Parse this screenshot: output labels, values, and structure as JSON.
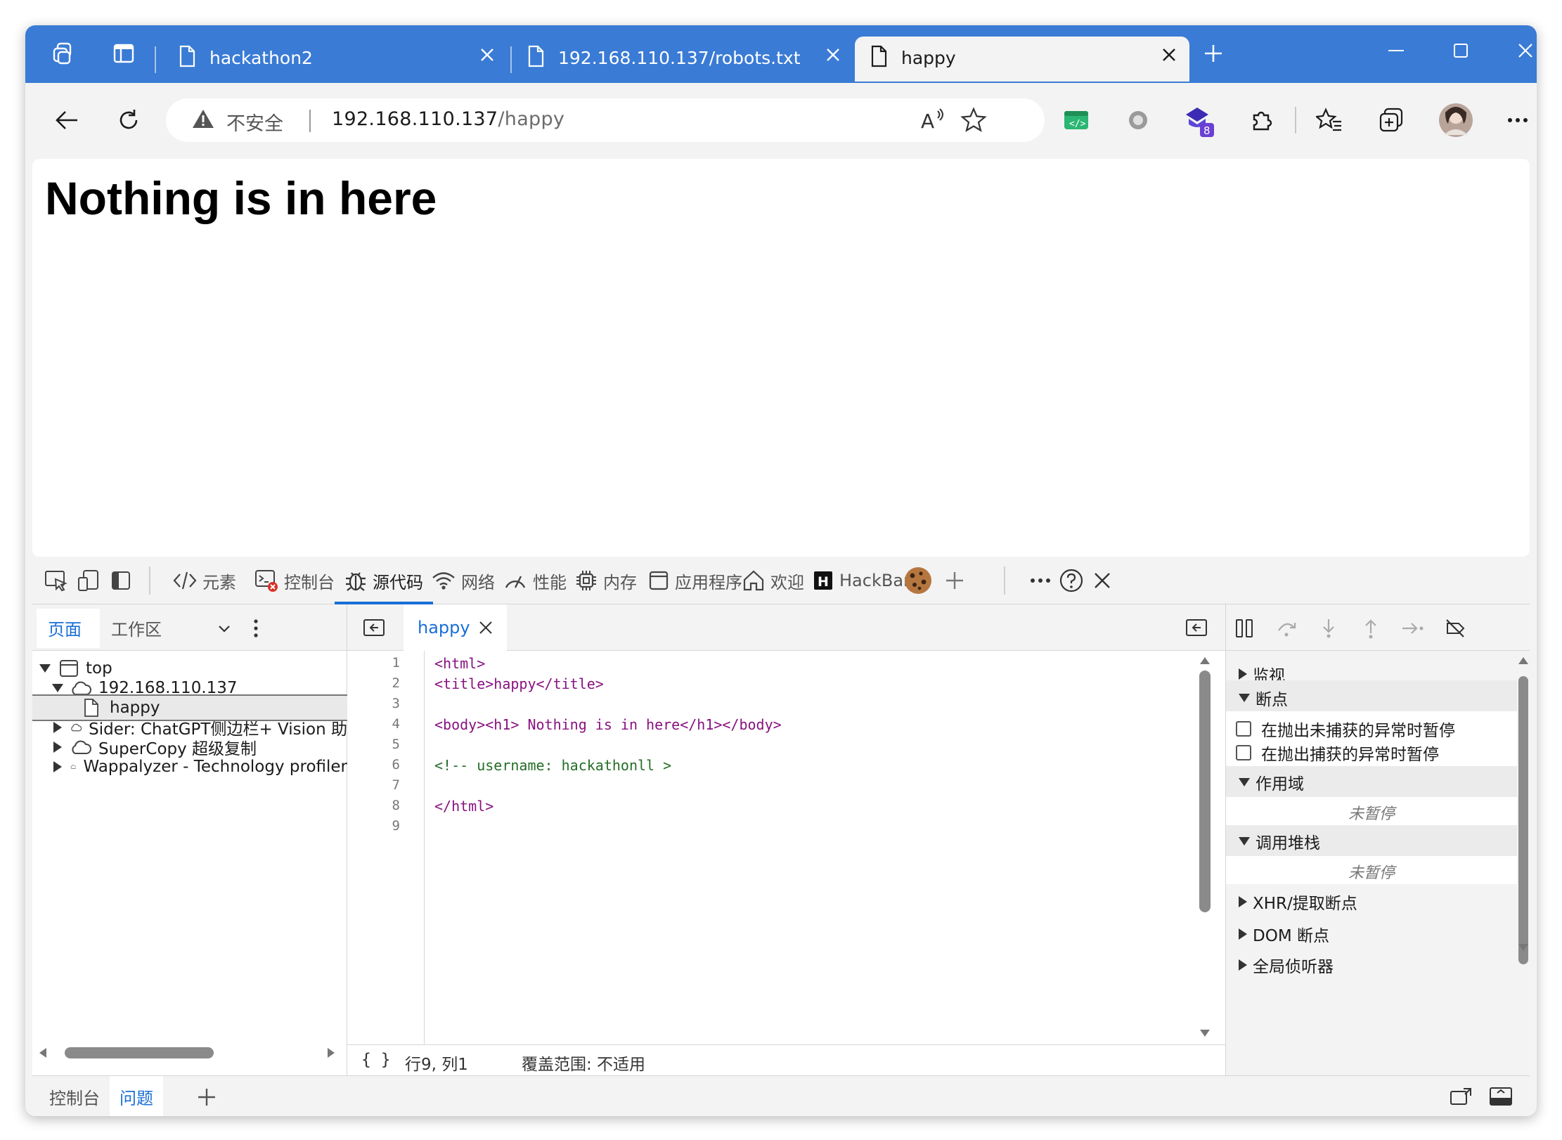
{
  "browser": {
    "tabs": [
      {
        "title": "hackathon2",
        "active": false
      },
      {
        "title": "192.168.110.137/robots.txt",
        "active": false
      },
      {
        "title": "happy",
        "active": true
      }
    ],
    "address": {
      "security_label": "不安全",
      "host": "192.168.110.137",
      "path": "/happy"
    },
    "extension_badge": "8"
  },
  "page": {
    "heading": "Nothing is in here"
  },
  "devtools": {
    "tabs": [
      {
        "label": "元素"
      },
      {
        "label": "控制台"
      },
      {
        "label": "源代码",
        "active": true
      },
      {
        "label": "网络"
      },
      {
        "label": "性能"
      },
      {
        "label": "内存"
      },
      {
        "label": "应用程序"
      },
      {
        "label": "欢迎"
      },
      {
        "label": "HackBar"
      }
    ],
    "navigator": {
      "tabs": [
        "页面",
        "工作区"
      ],
      "tree": [
        {
          "label": "top",
          "level": 0,
          "expanded": true,
          "icon": "frame-icon"
        },
        {
          "label": "192.168.110.137",
          "level": 1,
          "expanded": true,
          "icon": "cloud-icon"
        },
        {
          "label": "happy",
          "level": 2,
          "icon": "file-icon",
          "selected": true
        },
        {
          "label": "Sider: ChatGPT侧边栏+ Vision 助",
          "level": 1,
          "expanded": false,
          "icon": "cloud-icon"
        },
        {
          "label": "SuperCopy 超级复制",
          "level": 1,
          "expanded": false,
          "icon": "cloud-icon"
        },
        {
          "label": "Wappalyzer - Technology profiler",
          "level": 1,
          "expanded": false,
          "icon": "cloud-icon"
        }
      ]
    },
    "editor": {
      "file_tab": "happy",
      "line_numbers": [
        "1",
        "2",
        "3",
        "4",
        "5",
        "6",
        "7",
        "8",
        "9"
      ],
      "lines": [
        "<html>",
        "<title>happy</title>",
        "",
        "<body><h1> Nothing is in here</h1></body>",
        "",
        "<!-- username: hackathonll >",
        "",
        "</html>",
        ""
      ],
      "status": {
        "braces": "{ }",
        "position": "行9, 列1",
        "coverage": "覆盖范围: 不适用"
      }
    },
    "debugger": {
      "watch": "监视",
      "breakpoints": "断点",
      "pause_uncaught": "在抛出未捕获的异常时暂停",
      "pause_caught": "在抛出捕获的异常时暂停",
      "scope": "作用域",
      "scope_status": "未暂停",
      "callstack": "调用堆栈",
      "callstack_status": "未暂停",
      "xhr": "XHR/提取断点",
      "dom": "DOM 断点",
      "global": "全局侦听器"
    },
    "drawer": {
      "tabs": [
        "控制台",
        "问题"
      ],
      "active": "问题"
    }
  },
  "colors": {
    "titlebar": "#3a7bd5",
    "accent": "#1a6fd6",
    "tag": "#881280",
    "comment": "#236e25"
  }
}
